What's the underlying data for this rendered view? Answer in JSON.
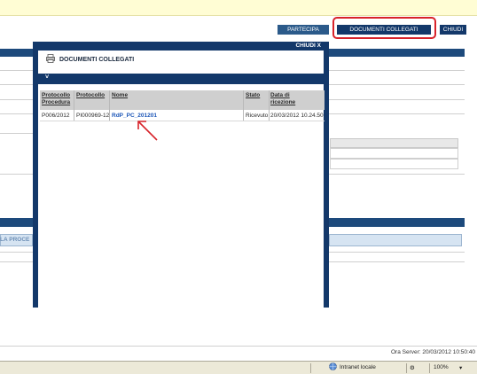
{
  "top_buttons": {
    "partecipa": "PARTECIPA",
    "documenti": "DOCUMENTI COLLEGATI",
    "chiudi": "CHIUDI"
  },
  "background": {
    "partial_label": "LA PROCE"
  },
  "modal": {
    "close_label": "CHIUDI X",
    "title": "DOCUMENTI COLLEGATI",
    "section_toggle": "˅",
    "columns": [
      "Protocollo Procedura",
      "Protocollo",
      "Nome",
      "Stato",
      "Data di ricezione"
    ],
    "rows": [
      {
        "protocollo_procedura": "P006/2012",
        "protocollo": "PI000969-12",
        "nome": "RdP_PC_201201",
        "stato": "Ricevuto",
        "data_ricezione": "20/03/2012 10.24.50"
      }
    ]
  },
  "footer": {
    "server_time": "Ora Server: 20/03/2012 10:50:40",
    "zone": "Intranet locale",
    "zoom": "100%"
  },
  "colors": {
    "accent": "#13386a",
    "highlight": "#d8232a",
    "link": "#1d57b8"
  }
}
